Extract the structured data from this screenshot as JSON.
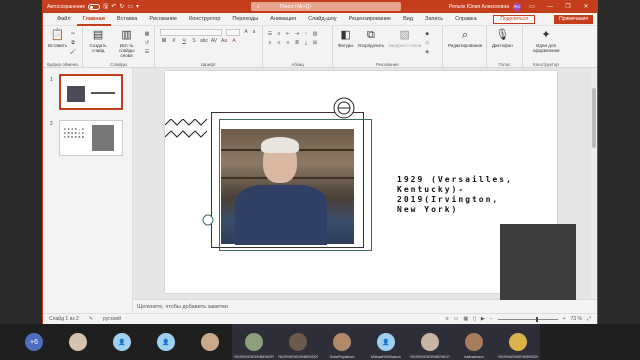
{
  "titlebar": {
    "autosave_label": "Автосохранение",
    "search_placeholder": "Поиск (Alt+Q)",
    "user_name": "Репьях Юлия Алексеевна",
    "user_initials": "РЮ"
  },
  "menu": {
    "tabs": [
      "Файл",
      "Главная",
      "Вставка",
      "Рисование",
      "Конструктор",
      "Переходы",
      "Анимация",
      "Слайд-шоу",
      "Рецензирование",
      "Вид",
      "Запись",
      "Справка"
    ],
    "share_label": "Поделиться",
    "comments_label": "Примечания"
  },
  "ribbon": {
    "paste": "Вставить",
    "create_slide": "Создать слайд",
    "reuse_slides": "Исп-ть слайды снова",
    "clipboard_group": "Буфер обмена",
    "slides_group": "Слайды",
    "font_group": "Шрифт",
    "paragraph_group": "Абзац",
    "shapes": "Фигуры",
    "arrange": "Упорядочить",
    "quick_styles": "Экспресс-стили",
    "drawing_group": "Рисование",
    "editing": "Редактирование",
    "dictation": "Диктофон",
    "voice_group": "Голос",
    "designer_ideas": "Идеи для оформления",
    "designer_group": "Конструктор"
  },
  "thumbnails": [
    {
      "number": "1"
    },
    {
      "number": "2",
      "text": "1 9 1 9 , S A M U E L S T E E P E R"
    }
  ],
  "slide": {
    "caption": "1929 (Versailles, Kentucky)- 2019(Irvington, New York)"
  },
  "notes_placeholder": "Щелкните, чтобы добавить заметки",
  "status": {
    "slide_info": "Слайд 1 из 2",
    "language": "русский",
    "zoom": "73 %"
  },
  "participants": [
    {
      "label": "+6"
    },
    {
      "label": ""
    },
    {
      "label": ""
    },
    {
      "label": ""
    },
    {
      "label": ""
    },
    {
      "label": "%D0%94%D0%B8%D0%B..."
    },
    {
      "label": "%D0%90%D0%BB%D0%B5..."
    },
    {
      "label": "SofiaPolyakova"
    },
    {
      "label": "Michael%20Ivanov"
    },
    {
      "label": "%D0%94%D0%B0%D1%80%..."
    },
    {
      "label": "kadrsamara"
    },
    {
      "label": "%D0%A0%D0%B5%D0%BF%..."
    }
  ]
}
